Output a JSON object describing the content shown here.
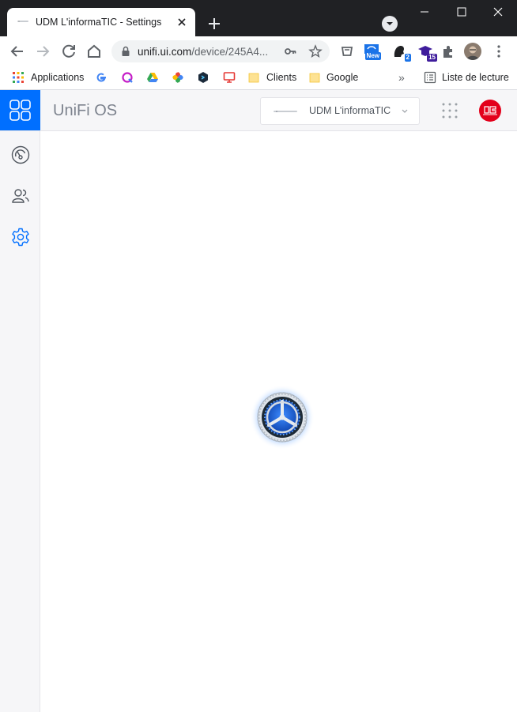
{
  "browser": {
    "tab_title": "UDM L'informaTIC - Settings",
    "url_host": "unifi.ui.com",
    "url_path": "/device/245A4...",
    "extensions": [
      {
        "name": "new-badge-extension",
        "badge": "New"
      },
      {
        "name": "black-extension",
        "badge": "2"
      },
      {
        "name": "purple-extension",
        "badge": "15"
      }
    ]
  },
  "bookmarks": {
    "items": [
      {
        "label": "Applications",
        "icon": "apps-grid-icon"
      },
      {
        "label": "",
        "icon": "google-icon"
      },
      {
        "label": "",
        "icon": "q-icon"
      },
      {
        "label": "",
        "icon": "drive-icon"
      },
      {
        "label": "",
        "icon": "pinwheel-icon"
      },
      {
        "label": "",
        "icon": "hexagon-icon"
      },
      {
        "label": "",
        "icon": "red-screen-icon"
      },
      {
        "label": "Clients",
        "icon": "folder-icon"
      },
      {
        "label": "Google",
        "icon": "folder-icon"
      }
    ],
    "overflow": "»",
    "reading_list": "Liste de lecture"
  },
  "app": {
    "brand": "UniFi OS",
    "device_name": "UDM L'informaTIC",
    "colors": {
      "accent": "#006fff",
      "avatar": "#e3001b"
    }
  },
  "sidebar": {
    "items": [
      {
        "name": "dashboard",
        "icon": "gauge-icon"
      },
      {
        "name": "users",
        "icon": "users-icon"
      },
      {
        "name": "settings",
        "icon": "gear-icon",
        "active": true
      }
    ]
  },
  "main": {
    "state": "loading",
    "spinner_icon": "settings-gear-spinner-icon"
  }
}
